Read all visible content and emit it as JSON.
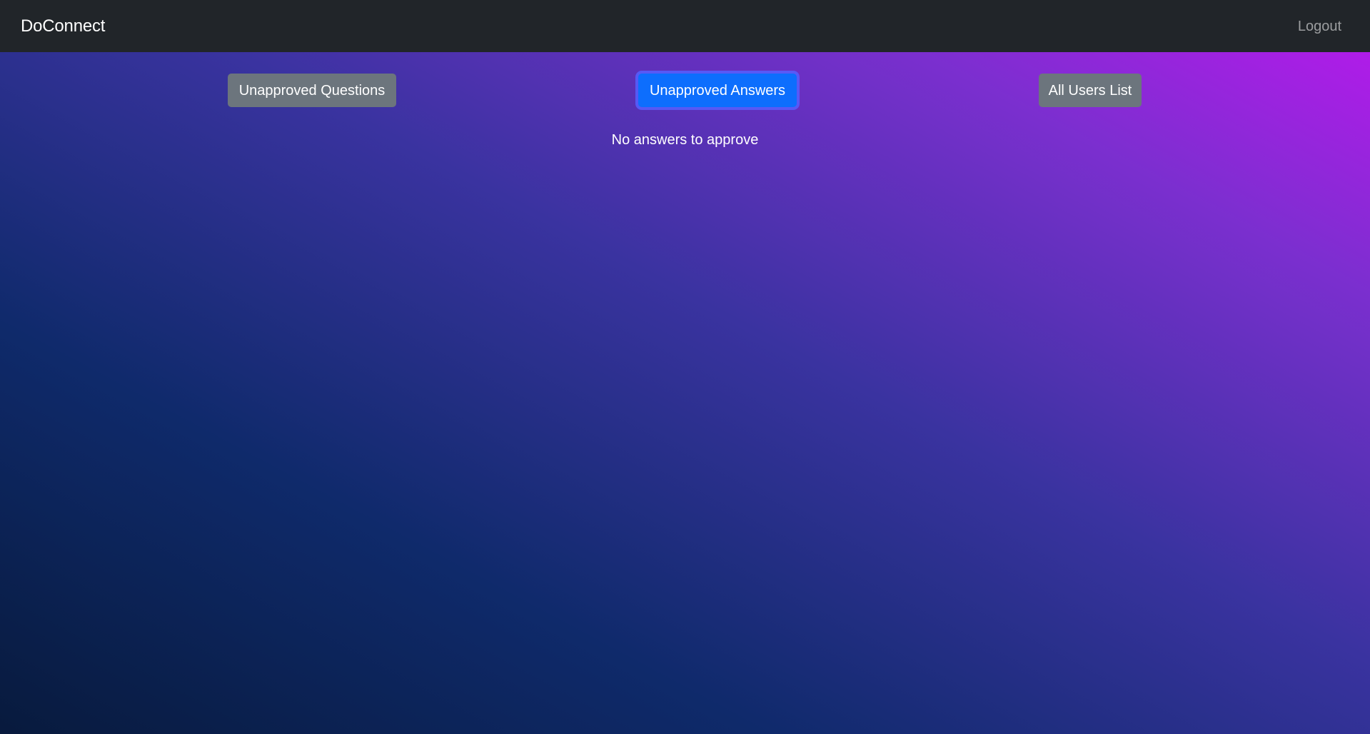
{
  "navbar": {
    "brand": "DoConnect",
    "logout_label": "Logout"
  },
  "tabs": [
    {
      "label": "Unapproved Questions",
      "active": false
    },
    {
      "label": "Unapproved Answers",
      "active": true
    },
    {
      "label": "All Users List",
      "active": false
    }
  ],
  "content": {
    "message": "No answers to approve"
  },
  "colors": {
    "navbar_bg": "#212529",
    "primary": "#0d6efd",
    "secondary": "#6c757d"
  }
}
